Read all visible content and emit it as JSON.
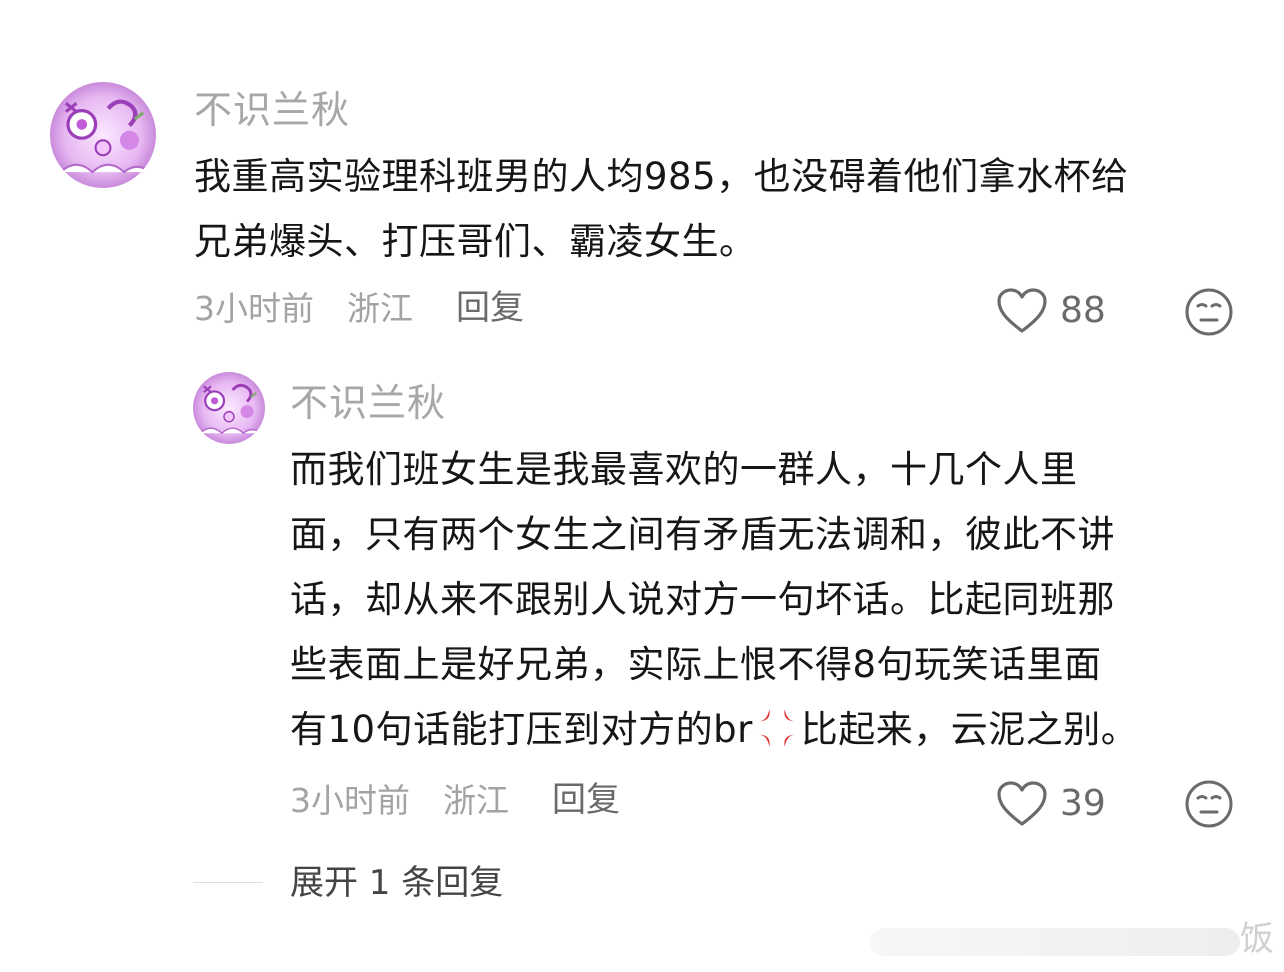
{
  "comment": {
    "username": "不识兰秋",
    "text": "我重高实验理科班男的人均985，也没碍着他们拿水杯给\n兄弟爆头、打压哥们、霸凌女生。",
    "time": "3小时前",
    "location": "浙江",
    "reply_label": "回复",
    "likes": "88"
  },
  "reply": {
    "username": "不识兰秋",
    "text_part1": "而我们班女生是我最喜欢的一群人，十几个人里\n面，只有两个女生之间有矛盾无法调和，彼此不讲\n话，却从来不跟别人说对方一句坏话。比起同班那\n些表面上是好兄弟，实际上恨不得8句玩笑话里面\n有10句话能打压到对方的br",
    "text_part2": "比起来，云泥之别。",
    "emoji": "anger-icon",
    "time": "3小时前",
    "location": "浙江",
    "reply_label": "回复",
    "likes": "39"
  },
  "expand": {
    "label": "展开 1 条回复"
  },
  "watermark": {
    "glyph": "饭"
  },
  "colors": {
    "username": "#a7a7a7",
    "text": "#161616",
    "meta": "#a3a3a3",
    "icon": "#6a6a6a",
    "avatar_accent": "#b04ec8"
  }
}
